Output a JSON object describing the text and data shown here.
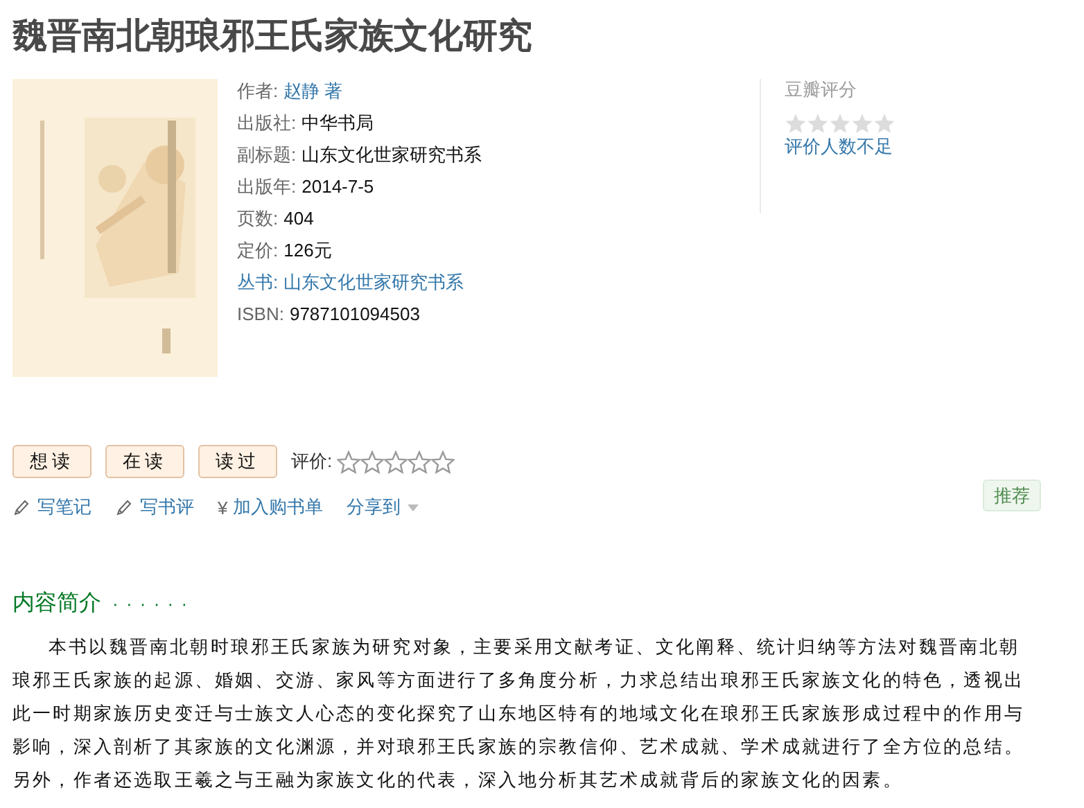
{
  "title": "魏晋南北朝琅邪王氏家族文化研究",
  "cover": {
    "kind": "picture"
  },
  "info": [
    {
      "label": "作者:",
      "value": "赵静 著",
      "kind": "link"
    },
    {
      "label": "出版社:",
      "value": "中华书局",
      "kind": "text"
    },
    {
      "label": "副标题:",
      "value": "山东文化世家研究书系",
      "kind": "text"
    },
    {
      "label": "出版年:",
      "value": "2014-7-5",
      "kind": "text"
    },
    {
      "label": "页数:",
      "value": "404",
      "kind": "text"
    },
    {
      "label": "定价:",
      "value": "126元",
      "kind": "text"
    },
    {
      "label": "丛书:",
      "value": "山东文化世家研究书系",
      "kind": "series"
    },
    {
      "label": "ISBN:",
      "value": "9787101094503",
      "kind": "text"
    }
  ],
  "douban_rating": {
    "heading": "豆瓣评分",
    "stars": 0,
    "note": "评价人数不足"
  },
  "status_buttons": [
    "想读",
    "在读",
    "读过"
  ],
  "my_rating": {
    "label": "评价:",
    "stars": 0
  },
  "actions": [
    {
      "kind": "pencil",
      "label": "写笔记"
    },
    {
      "kind": "pencil",
      "label": "写书评"
    },
    {
      "kind": "symbol",
      "symbol": "¥",
      "label": "加入购书单"
    },
    {
      "kind": "dropdown",
      "label": "分享到"
    }
  ],
  "recommend_button": "推荐",
  "intro": {
    "heading": "内容简介",
    "dots": "· · · · · ·",
    "text": "本书以魏晋南北朝时琅邪王氏家族为研究对象，主要采用文献考证、文化阐释、统计归纳等方法对魏晋南北朝琅邪王氏家族的起源、婚姻、交游、家风等方面进行了多角度分析，力求总结出琅邪王氏家族文化的特色，透视出此一时期家族历史变迁与士族文人心态的变化探究了山东地区特有的地域文化在琅邪王氏家族形成过程中的作用与影响，深入剖析了其家族的文化渊源，并对琅邪王氏家族的宗教信仰、艺术成就、学术成就进行了全方位的总结。另外，作者还选取王羲之与王融为家族文化的代表，深入地分析其艺术成就背后的家族文化的因素。"
  }
}
